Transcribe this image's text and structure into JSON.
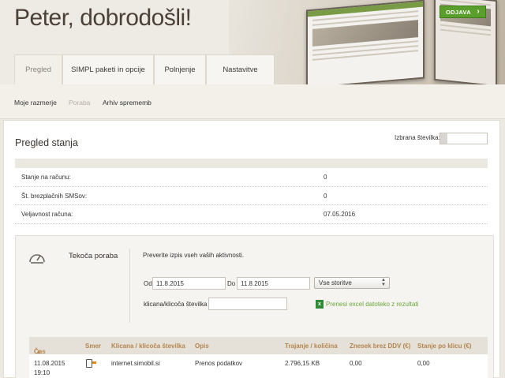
{
  "header": {
    "greeting": "Peter, dobrodošli!",
    "logout_label": "ODJAVA"
  },
  "tabs": [
    {
      "label": "Pregled",
      "active": true
    },
    {
      "label": "SIMPL paketi in opcije",
      "active": false
    },
    {
      "label": "Polnjenje",
      "active": false
    },
    {
      "label": "Nastavitve",
      "active": false
    }
  ],
  "subnav": [
    {
      "label": "Moje razmerje"
    },
    {
      "label": "Poraba"
    },
    {
      "label": "Arhiv sprememb"
    }
  ],
  "overview": {
    "title": "Pregled stanja",
    "selected_number_label": "Izbrana številka:",
    "rows": [
      {
        "label": "Stanje na računu:",
        "value": "0"
      },
      {
        "label": "Št. brezplačnih SMSov:",
        "value": "0"
      },
      {
        "label": "Veljavnost računa:",
        "value": "07.05.2016"
      }
    ]
  },
  "usage": {
    "title": "Tekoča poraba",
    "hint": "Preverite izpis vseh vaših aktivnosti.",
    "from_label": "Od",
    "from_value": "11.8.2015",
    "to_label": "Do",
    "to_value": "11.8.2015",
    "service_select": "Vse storitve",
    "caller_label": "klicana/klicoča številka",
    "excel_link": "Prenesi excel datoteko z rezultati",
    "columns": [
      "Čas",
      "Smer",
      "Klicana / klicoča številka",
      "Opis",
      "Trajanje / količina",
      "Znesek brez DDV (€)",
      "Stanje po klicu (€)"
    ],
    "rows": [
      {
        "time": "11.08.2015",
        "time2": "19:10",
        "number": "internet.simobil.si",
        "desc": "Prenos podatkov",
        "duration": "2.796,15 KB",
        "amount": "0,00",
        "balance": "0,00"
      }
    ]
  },
  "colors": {
    "accent_green": "#5a9e2c",
    "header_text": "#b4854f"
  }
}
